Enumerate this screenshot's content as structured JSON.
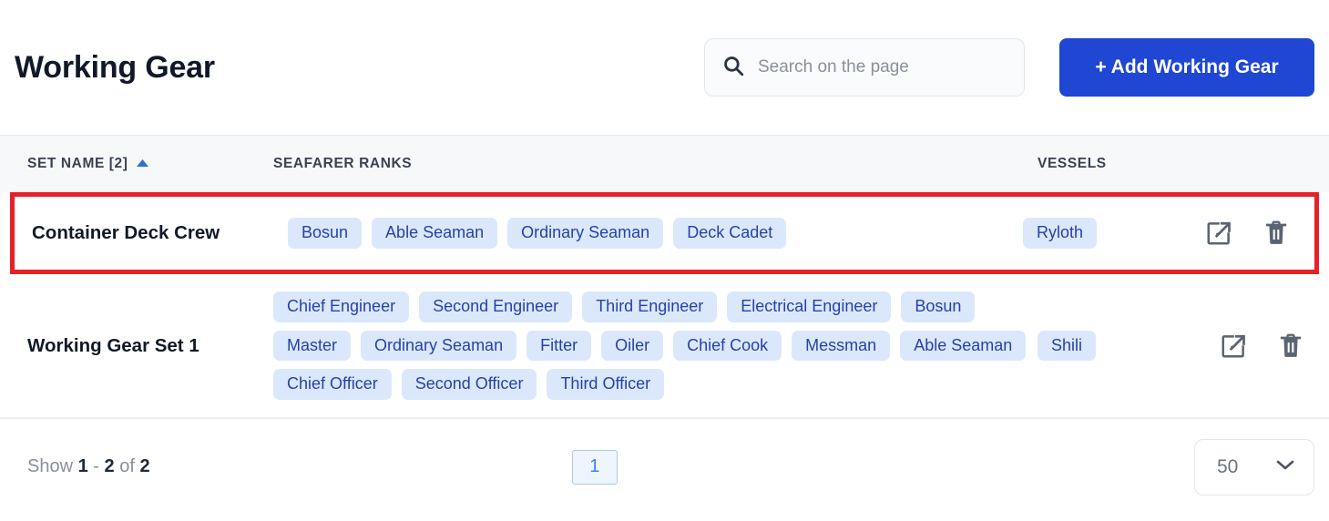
{
  "header": {
    "title": "Working Gear",
    "search": {
      "placeholder": "Search on the page",
      "value": "",
      "icon": "search-icon"
    },
    "add_button": {
      "label": "+ Add Working Gear",
      "color": "#1f47d4"
    }
  },
  "table": {
    "columns": [
      {
        "key": "set_name",
        "label": "SET NAME [2]",
        "sorted": "asc",
        "sort_icon": "sort-ascending-icon"
      },
      {
        "key": "seafarer_ranks",
        "label": "SEAFARER RANKS"
      },
      {
        "key": "vessels",
        "label": "VESSELS"
      },
      {
        "key": "actions",
        "label": ""
      }
    ],
    "rows": [
      {
        "set_name": "Container Deck Crew",
        "seafarer_ranks": [
          "Bosun",
          "Able Seaman",
          "Ordinary Seaman",
          "Deck Cadet"
        ],
        "vessels": [
          "Ryloth"
        ],
        "highlighted": true,
        "highlight_color": "#e52229",
        "actions": [
          "edit-icon",
          "delete-icon"
        ]
      },
      {
        "set_name": "Working Gear Set 1",
        "seafarer_ranks": [
          "Chief Engineer",
          "Second Engineer",
          "Third Engineer",
          "Electrical Engineer",
          "Bosun",
          "Master",
          "Ordinary Seaman",
          "Fitter",
          "Oiler",
          "Chief Cook",
          "Messman",
          "Able Seaman",
          "Chief Officer",
          "Second Officer",
          "Third Officer"
        ],
        "vessels": [
          "Shili"
        ],
        "highlighted": false,
        "actions": [
          "edit-icon",
          "delete-icon"
        ]
      }
    ],
    "tag_colors": {
      "background": "#dbe8fb",
      "text": "#2542ab"
    }
  },
  "footer": {
    "show_prefix": "Show",
    "range_from": "1",
    "range_separator": "-",
    "range_to": "2",
    "of_label": "of",
    "total": "2",
    "pagination": {
      "current_page": "1"
    },
    "per_page": {
      "value": "50",
      "icon": "chevron-down-icon"
    }
  }
}
